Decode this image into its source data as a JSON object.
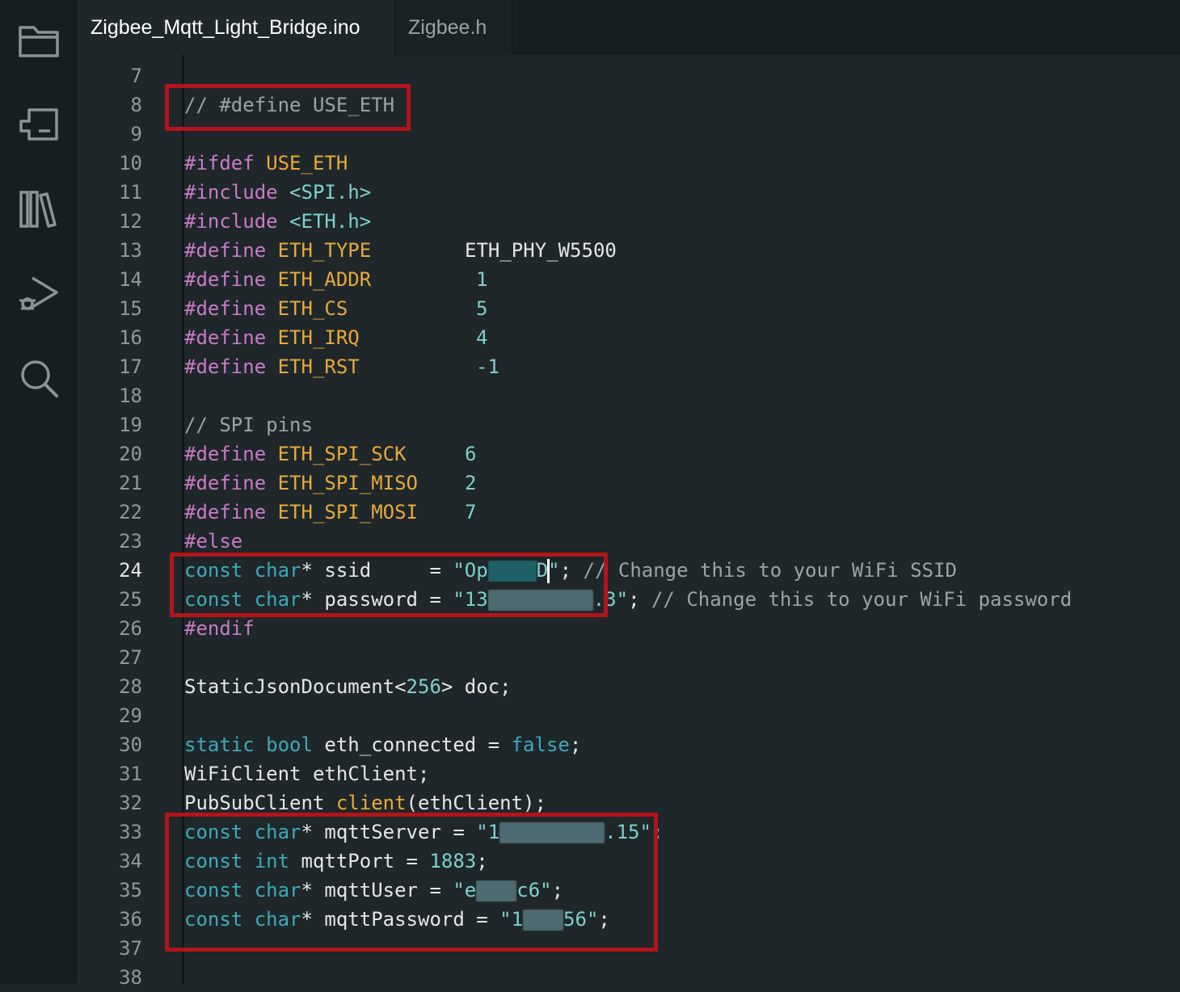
{
  "tabs": [
    {
      "label": "Zigbee_Mqtt_Light_Bridge.ino",
      "active": true
    },
    {
      "label": "Zigbee.h",
      "active": false
    }
  ],
  "activity_icons": [
    "folder-icon",
    "board-icon",
    "library-icon",
    "debug-icon",
    "search-icon"
  ],
  "colors": {
    "accent_box": "#b3141b",
    "keyword": "#3fa9b8",
    "preprocessor": "#c97bc5",
    "macro": "#e8a93a",
    "number": "#7fd0cc"
  },
  "lines": {
    "l7": {
      "num": "7"
    },
    "l8": {
      "num": "8",
      "comment": "// #define USE_ETH"
    },
    "l9": {
      "num": "9"
    },
    "l10": {
      "num": "10",
      "pre": "#ifdef",
      "macro": "USE_ETH"
    },
    "l11": {
      "num": "11",
      "pre": "#include",
      "hdr": "<SPI.h>"
    },
    "l12": {
      "num": "12",
      "pre": "#include",
      "hdr": "<ETH.h>"
    },
    "l13": {
      "num": "13",
      "pre": "#define",
      "macro": "ETH_TYPE",
      "value": "ETH_PHY_W5500"
    },
    "l14": {
      "num": "14",
      "pre": "#define",
      "macro": "ETH_ADDR",
      "value": "1"
    },
    "l15": {
      "num": "15",
      "pre": "#define",
      "macro": "ETH_CS",
      "value": "5"
    },
    "l16": {
      "num": "16",
      "pre": "#define",
      "macro": "ETH_IRQ",
      "value": "4"
    },
    "l17": {
      "num": "17",
      "pre": "#define",
      "macro": "ETH_RST",
      "value": "-1"
    },
    "l18": {
      "num": "18"
    },
    "l19": {
      "num": "19",
      "comment": "// SPI pins"
    },
    "l20": {
      "num": "20",
      "pre": "#define",
      "macro": "ETH_SPI_SCK",
      "value": "6"
    },
    "l21": {
      "num": "21",
      "pre": "#define",
      "macro": "ETH_SPI_MISO",
      "value": "2"
    },
    "l22": {
      "num": "22",
      "pre": "#define",
      "macro": "ETH_SPI_MOSI",
      "value": "7"
    },
    "l23": {
      "num": "23",
      "pre": "#else"
    },
    "l24": {
      "num": "24",
      "kw1": "const",
      "kw2": "char",
      "rest": "* ssid     = ",
      "str_a": "\"Op",
      "str_b": "D",
      "str_c": "\"",
      "tail": "; ",
      "comment": "// Change this to your WiFi SSID"
    },
    "l25": {
      "num": "25",
      "kw1": "const",
      "kw2": "char",
      "rest": "* password = ",
      "str_a": "\"13",
      "str_b": ".3\"",
      "tail": "; ",
      "comment": "// Change this to your WiFi password"
    },
    "l26": {
      "num": "26",
      "pre": "#endif"
    },
    "l27": {
      "num": "27"
    },
    "l28": {
      "num": "28",
      "a": "StaticJsonDocument<",
      "n": "256",
      "b": "> doc;"
    },
    "l29": {
      "num": "29"
    },
    "l30": {
      "num": "30",
      "kw1": "static",
      "kw2": "bool",
      "rest": " eth_connected = ",
      "kw3": "false",
      "tail": ";"
    },
    "l31": {
      "num": "31",
      "text": "WiFiClient ethClient;"
    },
    "l32": {
      "num": "32",
      "a": "PubSubClient ",
      "fn": "client",
      "b": "(ethClient);"
    },
    "l33": {
      "num": "33",
      "kw1": "const",
      "kw2": "char",
      "rest": "* mqttServer = ",
      "str_a": "\"1",
      "str_b": ".15\"",
      "tail": ";"
    },
    "l34": {
      "num": "34",
      "kw1": "const",
      "kw2": "int",
      "rest": " mqttPort = ",
      "n": "1883",
      "tail": ";"
    },
    "l35": {
      "num": "35",
      "kw1": "const",
      "kw2": "char",
      "rest": "* mqttUser = ",
      "str_a": "\"e",
      "str_b": "c6\"",
      "tail": ";"
    },
    "l36": {
      "num": "36",
      "kw1": "const",
      "kw2": "char",
      "rest": "* mqttPassword = ",
      "str_a": "\"1",
      "str_b": "56\"",
      "tail": ";"
    },
    "l37": {
      "num": "37"
    },
    "l38": {
      "num": "38"
    }
  }
}
